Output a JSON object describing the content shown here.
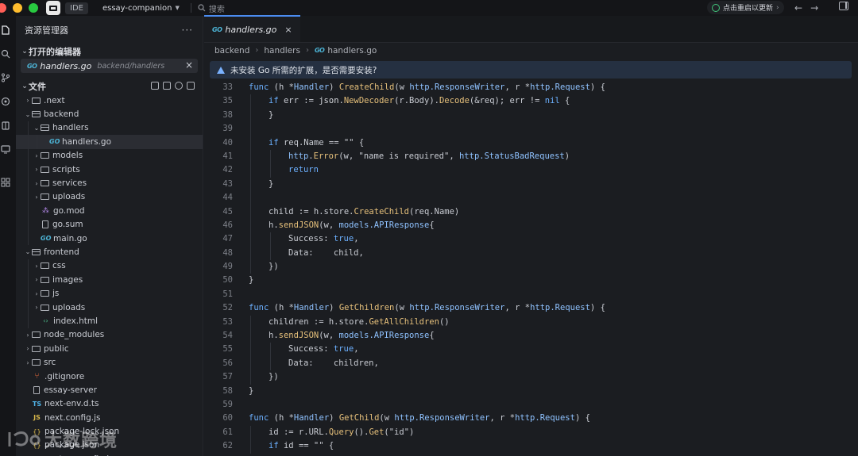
{
  "titlebar": {
    "ide_label": "IDE",
    "project": "essay-companion",
    "search_placeholder": "搜索",
    "restart_label": "点击重启以更新"
  },
  "sidebar": {
    "title": "资源管理器",
    "open_editors_title": "打开的编辑器",
    "open_editor": {
      "name": "handlers.go",
      "path": "backend/handlers"
    },
    "files_title": "文件",
    "tree": [
      {
        "label": ".next",
        "type": "folder",
        "depth": 0,
        "open": false
      },
      {
        "label": "backend",
        "type": "folder",
        "depth": 0,
        "open": true
      },
      {
        "label": "handlers",
        "type": "folder",
        "depth": 1,
        "open": true
      },
      {
        "label": "handlers.go",
        "type": "go",
        "depth": 2,
        "selected": true
      },
      {
        "label": "models",
        "type": "folder",
        "depth": 1,
        "open": false
      },
      {
        "label": "scripts",
        "type": "folder",
        "depth": 1,
        "open": false
      },
      {
        "label": "services",
        "type": "folder",
        "depth": 1,
        "open": false
      },
      {
        "label": "uploads",
        "type": "folder",
        "depth": 1,
        "open": false
      },
      {
        "label": "go.mod",
        "type": "mod",
        "depth": 1
      },
      {
        "label": "go.sum",
        "type": "file",
        "depth": 1
      },
      {
        "label": "main.go",
        "type": "go",
        "depth": 1
      },
      {
        "label": "frontend",
        "type": "folder",
        "depth": 0,
        "open": true
      },
      {
        "label": "css",
        "type": "folder",
        "depth": 1,
        "open": false
      },
      {
        "label": "images",
        "type": "folder",
        "depth": 1,
        "open": false
      },
      {
        "label": "js",
        "type": "folder",
        "depth": 1,
        "open": false
      },
      {
        "label": "uploads",
        "type": "folder",
        "depth": 1,
        "open": false
      },
      {
        "label": "index.html",
        "type": "html",
        "depth": 1
      },
      {
        "label": "node_modules",
        "type": "folder",
        "depth": 0,
        "open": false
      },
      {
        "label": "public",
        "type": "folder",
        "depth": 0,
        "open": false
      },
      {
        "label": "src",
        "type": "folder",
        "depth": 0,
        "open": false
      },
      {
        "label": ".gitignore",
        "type": "git",
        "depth": 0
      },
      {
        "label": "essay-server",
        "type": "file",
        "depth": 0
      },
      {
        "label": "next-env.d.ts",
        "type": "ts",
        "depth": 0
      },
      {
        "label": "next.config.js",
        "type": "js",
        "depth": 0
      },
      {
        "label": "package-lock.json",
        "type": "json",
        "depth": 0
      },
      {
        "label": "package.json",
        "type": "json",
        "depth": 0
      },
      {
        "label": "postcss.config.js",
        "type": "js",
        "depth": 0
      }
    ]
  },
  "editor": {
    "tab": {
      "name": "handlers.go"
    },
    "breadcrumb": [
      "backend",
      "handlers",
      "handlers.go"
    ],
    "notice": "未安装 Go 所需的扩展，是否需要安装?",
    "lines": [
      {
        "n": "33",
        "indent": 0,
        "tokens": [
          [
            "kw",
            "func"
          ],
          [
            "p",
            " (h *"
          ],
          [
            "ty",
            "Handler"
          ],
          [
            "p",
            ") "
          ],
          [
            "fn",
            "CreateChild"
          ],
          [
            "p",
            "(w "
          ],
          [
            "ty",
            "http.ResponseWriter"
          ],
          [
            "p",
            ", r *"
          ],
          [
            "ty",
            "http.Request"
          ],
          [
            "p",
            ") {"
          ]
        ]
      },
      {
        "n": "35",
        "indent": 1,
        "tokens": [
          [
            "kw",
            "if"
          ],
          [
            "p",
            " err := "
          ],
          [
            "fld",
            "json"
          ],
          [
            "p",
            "."
          ],
          [
            "fn",
            "NewDecoder"
          ],
          [
            "p",
            "(r.Body)."
          ],
          [
            "fn",
            "Decode"
          ],
          [
            "p",
            "(&req); err != "
          ],
          [
            "cn",
            "nil"
          ],
          [
            "p",
            " {"
          ]
        ]
      },
      {
        "n": "38",
        "indent": 1,
        "tokens": [
          [
            "p",
            "}"
          ]
        ]
      },
      {
        "n": "39",
        "indent": 1,
        "tokens": []
      },
      {
        "n": "40",
        "indent": 1,
        "tokens": [
          [
            "kw",
            "if"
          ],
          [
            "p",
            " req.Name == "
          ],
          [
            "st",
            "\"\""
          ],
          [
            "p",
            " {"
          ]
        ]
      },
      {
        "n": "41",
        "indent": 2,
        "tokens": [
          [
            "ty",
            "http"
          ],
          [
            "p",
            "."
          ],
          [
            "fn",
            "Error"
          ],
          [
            "p",
            "(w, "
          ],
          [
            "st",
            "\"name is required\""
          ],
          [
            "p",
            ", "
          ],
          [
            "ty",
            "http.StatusBadRequest"
          ],
          [
            "p",
            ")"
          ]
        ]
      },
      {
        "n": "42",
        "indent": 2,
        "tokens": [
          [
            "kw",
            "return"
          ]
        ]
      },
      {
        "n": "43",
        "indent": 1,
        "tokens": [
          [
            "p",
            "}"
          ]
        ]
      },
      {
        "n": "44",
        "indent": 1,
        "tokens": []
      },
      {
        "n": "45",
        "indent": 1,
        "tokens": [
          [
            "p",
            "child := h.store."
          ],
          [
            "fn",
            "CreateChild"
          ],
          [
            "p",
            "(req.Name)"
          ]
        ]
      },
      {
        "n": "46",
        "indent": 1,
        "tokens": [
          [
            "p",
            "h."
          ],
          [
            "fn",
            "sendJSON"
          ],
          [
            "p",
            "(w, "
          ],
          [
            "ty",
            "models.APIResponse"
          ],
          [
            "p",
            "{"
          ]
        ]
      },
      {
        "n": "47",
        "indent": 2,
        "tokens": [
          [
            "p",
            "Success: "
          ],
          [
            "cn",
            "true"
          ],
          [
            "p",
            ","
          ]
        ]
      },
      {
        "n": "48",
        "indent": 2,
        "tokens": [
          [
            "p",
            "Data:    child,"
          ]
        ]
      },
      {
        "n": "49",
        "indent": 1,
        "tokens": [
          [
            "p",
            "})"
          ]
        ]
      },
      {
        "n": "50",
        "indent": 0,
        "tokens": [
          [
            "p",
            "}"
          ]
        ]
      },
      {
        "n": "51",
        "indent": 0,
        "tokens": []
      },
      {
        "n": "52",
        "indent": 0,
        "tokens": [
          [
            "kw",
            "func"
          ],
          [
            "p",
            " (h *"
          ],
          [
            "ty",
            "Handler"
          ],
          [
            "p",
            ") "
          ],
          [
            "fn",
            "GetChildren"
          ],
          [
            "p",
            "(w "
          ],
          [
            "ty",
            "http.ResponseWriter"
          ],
          [
            "p",
            ", r *"
          ],
          [
            "ty",
            "http.Request"
          ],
          [
            "p",
            ") {"
          ]
        ]
      },
      {
        "n": "53",
        "indent": 1,
        "tokens": [
          [
            "p",
            "children := h.store."
          ],
          [
            "fn",
            "GetAllChildren"
          ],
          [
            "p",
            "()"
          ]
        ]
      },
      {
        "n": "54",
        "indent": 1,
        "tokens": [
          [
            "p",
            "h."
          ],
          [
            "fn",
            "sendJSON"
          ],
          [
            "p",
            "(w, "
          ],
          [
            "ty",
            "models.APIResponse"
          ],
          [
            "p",
            "{"
          ]
        ]
      },
      {
        "n": "55",
        "indent": 2,
        "tokens": [
          [
            "p",
            "Success: "
          ],
          [
            "cn",
            "true"
          ],
          [
            "p",
            ","
          ]
        ]
      },
      {
        "n": "56",
        "indent": 2,
        "tokens": [
          [
            "p",
            "Data:    children,"
          ]
        ]
      },
      {
        "n": "57",
        "indent": 1,
        "tokens": [
          [
            "p",
            "})"
          ]
        ]
      },
      {
        "n": "58",
        "indent": 0,
        "tokens": [
          [
            "p",
            "}"
          ]
        ]
      },
      {
        "n": "59",
        "indent": 0,
        "tokens": []
      },
      {
        "n": "60",
        "indent": 0,
        "tokens": [
          [
            "kw",
            "func"
          ],
          [
            "p",
            " (h *"
          ],
          [
            "ty",
            "Handler"
          ],
          [
            "p",
            ") "
          ],
          [
            "fn",
            "GetChild"
          ],
          [
            "p",
            "(w "
          ],
          [
            "ty",
            "http.ResponseWriter"
          ],
          [
            "p",
            ", r *"
          ],
          [
            "ty",
            "http.Request"
          ],
          [
            "p",
            ") {"
          ]
        ]
      },
      {
        "n": "61",
        "indent": 1,
        "tokens": [
          [
            "p",
            "id := r.URL."
          ],
          [
            "fn",
            "Query"
          ],
          [
            "p",
            "()."
          ],
          [
            "fn",
            "Get"
          ],
          [
            "p",
            "("
          ],
          [
            "st",
            "\"id\""
          ],
          [
            "p",
            ")"
          ]
        ]
      },
      {
        "n": "62",
        "indent": 1,
        "tokens": [
          [
            "kw",
            "if"
          ],
          [
            "p",
            " id == "
          ],
          [
            "st",
            "\"\""
          ],
          [
            "p",
            " {"
          ]
        ]
      }
    ]
  },
  "watermark": {
    "text": "大数跨境"
  },
  "colors": {
    "accent": "#4b8cf0",
    "notice_bg": "#253041",
    "go": "#4cb4d6"
  }
}
